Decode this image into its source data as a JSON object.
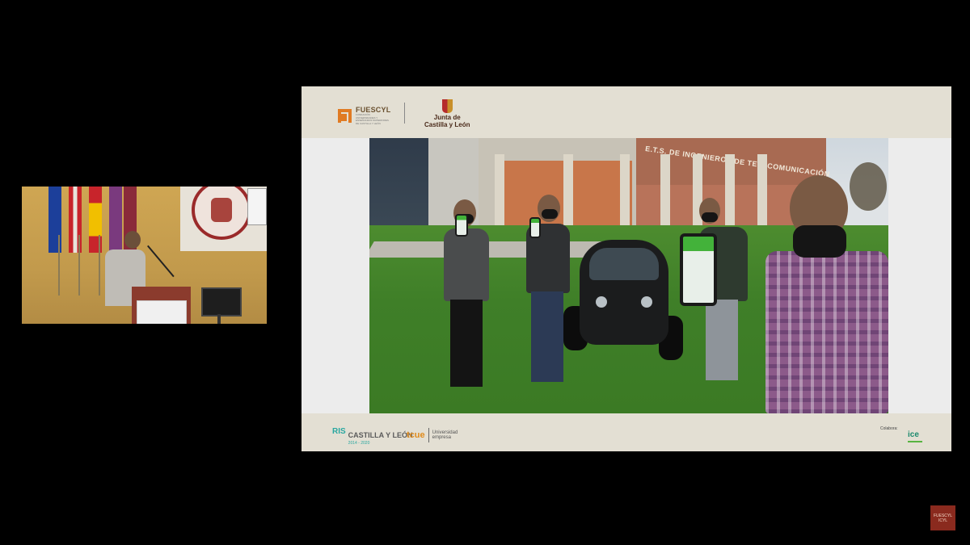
{
  "slide": {
    "header": {
      "fuescyl_name": "FUESCYL",
      "fuescyl_tagline": "FUNDACIÓN UNIVERSIDADES Y ENSEÑANZAS SUPERIORES DE CASTILLA Y LEÓN",
      "junta_line1": "Junta de",
      "junta_line2": "Castilla y León"
    },
    "photo": {
      "building_sign": "E.T.S. DE INGENIEROS DE TELECOMUNICACIÓN"
    },
    "footer": {
      "ris3": "RIS",
      "ris3_region": "CASTILLA Y LEÓN",
      "ris3_years": "2014 - 2020",
      "tcue": "tcue",
      "tcue_subtitle": "Universidad empresa",
      "colabora": "Colabora:",
      "ice": "ice"
    }
  },
  "watermark": {
    "line1": "FUESCYL",
    "line2": "ICYL"
  },
  "colors": {
    "background": "#000000",
    "slide_band": "#e3dfd3",
    "fuescyl_orange": "#e07b23",
    "app_green": "#43b23a",
    "watermark_red": "#8a2a1e"
  }
}
